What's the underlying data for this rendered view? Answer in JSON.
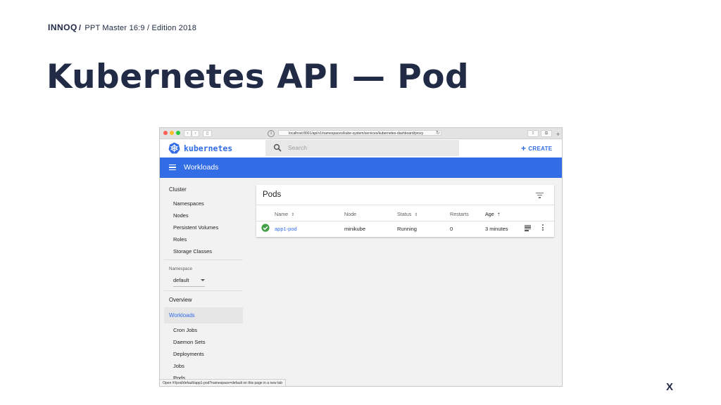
{
  "slide": {
    "brand": "INNOQ",
    "separator": "/",
    "subtitle": "PPT Master 16:9 / Edition 2018",
    "title": "Kubernetes API — Pod",
    "corner_mark": "X"
  },
  "browser": {
    "url": "localhost:8001/api/v1/namespaces/kube-system/services/kubernetes-dashboard/proxy",
    "status_text": "Open #!/pod/default/app1-pod?namespace=default on this page in a new tab"
  },
  "dashboard": {
    "logo_text": "kubernetes",
    "search_placeholder": "Search",
    "create_label": "CREATE",
    "section_title": "Workloads",
    "sidebar": {
      "cluster_header": "Cluster",
      "cluster_items": [
        "Namespaces",
        "Nodes",
        "Persistent Volumes",
        "Roles",
        "Storage Classes"
      ],
      "namespace_label": "Namespace",
      "namespace_value": "default",
      "overview": "Overview",
      "workloads": "Workloads",
      "workload_items": [
        "Cron Jobs",
        "Daemon Sets",
        "Deployments",
        "Jobs",
        "Pods"
      ]
    },
    "pods_card": {
      "title": "Pods",
      "columns": [
        "Name",
        "Node",
        "Status",
        "Restarts",
        "Age"
      ],
      "rows": [
        {
          "name": "app1-pod",
          "node": "minikube",
          "status": "Running",
          "restarts": "0",
          "age": "3 minutes"
        }
      ]
    }
  },
  "colors": {
    "k8s_blue": "#326ce5",
    "slide_navy": "#222b45",
    "running_green": "#43a047"
  }
}
